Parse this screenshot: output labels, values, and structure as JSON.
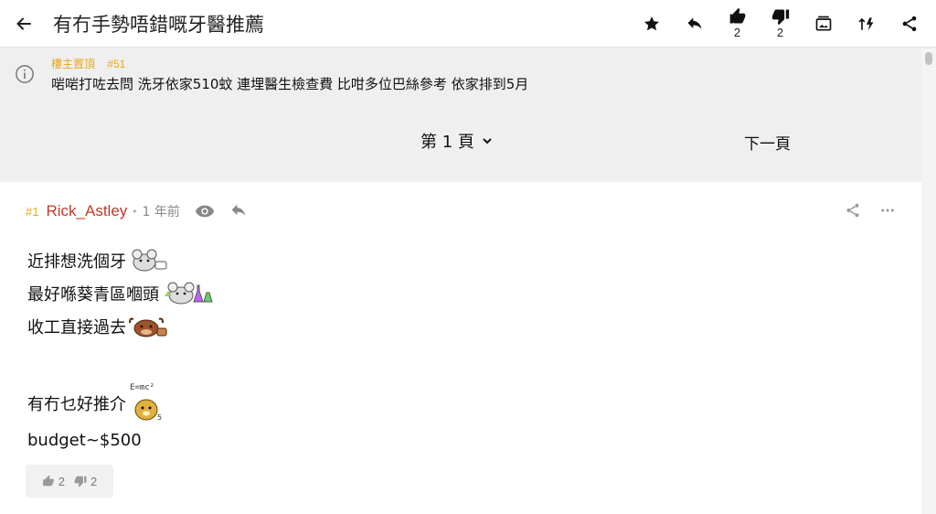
{
  "header": {
    "title": "有冇手勢唔錯嘅牙醫推薦",
    "like_count": "2",
    "dislike_count": "2",
    "icons": [
      "back-arrow-icon",
      "star-icon",
      "reply-icon",
      "thumbs-up-icon",
      "thumbs-down-icon",
      "image-icon",
      "sort-icon",
      "share-icon"
    ]
  },
  "pinned": {
    "label": "樓主置頂",
    "floor": "#51",
    "text": "啱啱打咗去問 洗牙依家510蚊 連埋醫生檢查費 比咁多位巴絲參考 依家排到5月"
  },
  "pager": {
    "current_page": "第 1 頁",
    "next_label": "下一頁"
  },
  "post": {
    "floor": "#1",
    "author": "Rick_Astley",
    "time": "1 年前",
    "lines": [
      "近排想洗個牙",
      "最好喺葵青區嗰頭",
      "收工直接過去",
      "",
      "有冇乜好推介",
      "budget~$500"
    ],
    "emoji_caption": "E=mc²",
    "up_votes": "2",
    "down_votes": "2"
  },
  "colors": {
    "accent_yellow": "#e6a817",
    "author_red": "#c0392b",
    "background": "#efefef"
  }
}
